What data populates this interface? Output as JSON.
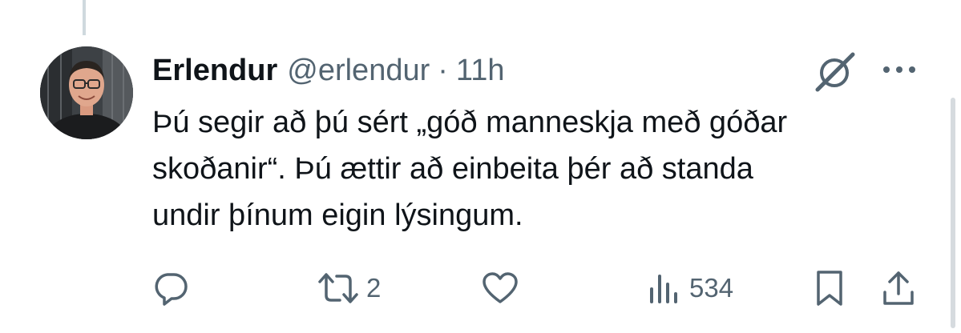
{
  "tweet": {
    "author_name": "Erlendur",
    "handle": "@erlendur",
    "separator": "·",
    "timestamp": "11h",
    "text_lines": [
      "Þú segir að þú sért „góð manneskja með góðar",
      "skoðanir“. Þú ættir að einbeita þér að standa",
      "undir þínum eigin lýsingum."
    ]
  },
  "actions": {
    "reply": {
      "icon": "reply-icon",
      "count": ""
    },
    "repost": {
      "icon": "repost-icon",
      "count": "2"
    },
    "like": {
      "icon": "heart-icon",
      "count": ""
    },
    "views": {
      "icon": "views-chart-icon",
      "count": "534"
    },
    "bookmark": {
      "icon": "bookmark-icon"
    },
    "share": {
      "icon": "share-icon"
    }
  },
  "header_icons": {
    "grok": "grok-icon",
    "more": "more-dots-icon"
  },
  "colors": {
    "text_primary": "#0f1419",
    "text_secondary": "#536471",
    "thread_line": "#cfd9de",
    "background": "#ffffff"
  }
}
